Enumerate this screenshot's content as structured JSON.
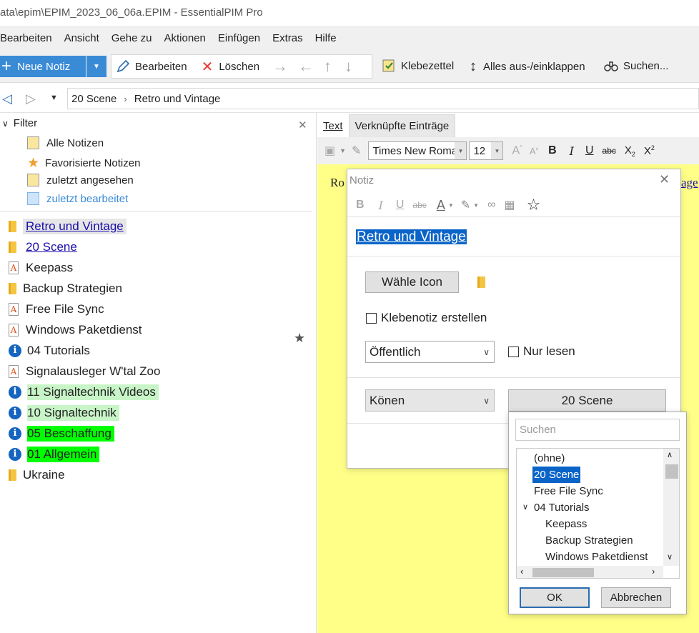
{
  "window": {
    "title": "ata\\epim\\EPIM_2023_06_06a.EPIM - EssentialPIM Pro"
  },
  "menu": [
    "Bearbeiten",
    "Ansicht",
    "Gehe zu",
    "Aktionen",
    "Einfügen",
    "Extras",
    "Hilfe"
  ],
  "toolbar": {
    "new_note": "Neue Notiz",
    "edit": "Bearbeiten",
    "delete": "Löschen",
    "sticky": "Klebezettel",
    "expand_all": "Alles aus-/einklappen",
    "search": "Suchen..."
  },
  "breadcrumb": {
    "items": [
      "20 Scene",
      "Retro und Vintage"
    ]
  },
  "filter": {
    "title": "Filter",
    "items": [
      "Alle Notizen",
      "Favorisierte Notizen",
      "zuletzt angesehen",
      "zuletzt bearbeitet"
    ]
  },
  "tree": [
    {
      "label": "Retro und Vintage",
      "icon": "folder-icon",
      "link": true,
      "selected": true
    },
    {
      "label": "20 Scene",
      "icon": "folder-icon",
      "link": true
    },
    {
      "label": "Keepass",
      "icon": "note-a-icon"
    },
    {
      "label": "Backup Strategien",
      "icon": "folder-icon"
    },
    {
      "label": "Free File Sync",
      "icon": "note-a-icon"
    },
    {
      "label": "Windows Paketdienst",
      "icon": "note-a-icon"
    },
    {
      "label": "04 Tutorials",
      "icon": "info-icon"
    },
    {
      "label": "Signalausleger W'tal Zoo",
      "icon": "note-a-icon"
    },
    {
      "label": "11 Signaltechnik Videos",
      "icon": "info-icon",
      "highlight": "#c8f5c8"
    },
    {
      "label": "10 Signaltechnik",
      "icon": "info-icon",
      "highlight": "#c8f5c8"
    },
    {
      "label": "05 Beschaffung",
      "icon": "info-icon",
      "highlight": "#00ff00"
    },
    {
      "label": "01 Allgemein",
      "icon": "info-icon",
      "highlight": "#00ff00"
    },
    {
      "label": "Ukraine",
      "icon": "folder-icon"
    }
  ],
  "editor_tabs": [
    "Text",
    "Verknüpfte Einträge"
  ],
  "format": {
    "font": "Times New Roma",
    "size": "12"
  },
  "editor": {
    "text_start": "Ro",
    "link_tail": "age"
  },
  "dialog": {
    "title": "Notiz",
    "note_title": "Retro und Vintage",
    "choose_icon": "Wähle Icon",
    "sticky_checkbox": "Klebenotiz erstellen",
    "visibility": "Öffentlich",
    "readonly": "Nur lesen",
    "category": "Könen",
    "parent": "20 Scene"
  },
  "popup": {
    "search_placeholder": "Suchen",
    "items": [
      "(ohne)",
      "20 Scene",
      "Free File Sync",
      "04 Tutorials",
      "Keepass",
      "Backup Strategien",
      "Windows Paketdienst"
    ],
    "ok": "OK",
    "cancel": "Abbrechen"
  },
  "colors": {
    "accent": "#3a8bd6",
    "editor_bg": "#ffff88",
    "selection": "#0a64c8"
  }
}
